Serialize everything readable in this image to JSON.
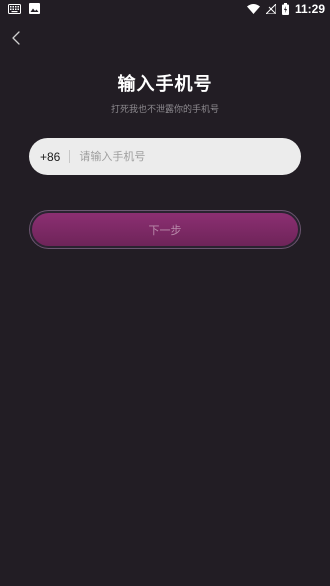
{
  "status_bar": {
    "time": "11:29",
    "left_icons": [
      "keyboard-icon",
      "image-icon"
    ],
    "right_icons": [
      "wifi-icon",
      "signal-icon",
      "battery-icon"
    ]
  },
  "header": {
    "back_icon": "chevron-left-icon"
  },
  "main": {
    "title": "输入手机号",
    "subtitle": "打死我也不泄露你的手机号",
    "country_code": "+86",
    "phone_placeholder": "请输入手机号",
    "phone_value": "",
    "next_label": "下一步"
  },
  "colors": {
    "background": "#221d24",
    "input_background": "#ececec",
    "button_gradient_top": "#8c2f72",
    "button_gradient_bottom": "#6e2459",
    "button_text": "#b98bab",
    "subtitle_text": "#8d8a8f"
  }
}
